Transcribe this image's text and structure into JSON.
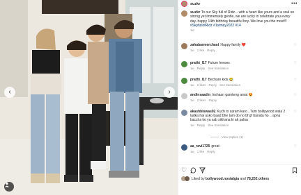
{
  "post": {
    "username": "suzkr",
    "caption_user": "suzkr",
    "caption_text": "To our Sky full of Ridz... with a heart like yours and a soul so strong yet immensely gentle, we are lucky to celebrate you every day..happy 14th birthday beautiful boy..We love you the most!!!",
    "caption_tags": "#SkyfullofRidz #1stmay2022 #14",
    "caption_time": "1w"
  },
  "comments": [
    {
      "user": "zahabarmerchant",
      "text": "Happy family ❤️",
      "time": "1w",
      "likes": "1 like",
      "reply": "Reply",
      "see": ""
    },
    {
      "user": "prathi_l17",
      "text": "Future heroes",
      "time": "1w",
      "likes": "",
      "reply": "Reply",
      "see": "See translation"
    },
    {
      "user": "prathi_l17",
      "text": "Bechare kids 😂",
      "time": "1w",
      "likes": "2 likes",
      "reply": "Reply",
      "see": "See translation"
    },
    {
      "user": "andinsaadin",
      "text": "Inshaan gamteng amat 😍",
      "time": "1w",
      "likes": "2 likes",
      "reply": "Reply",
      "see": ""
    },
    {
      "user": "akashbiswas92",
      "text": "Kuch to saram karo ..Tum bolllywood wala 2 ladka hai usko baad bhe tum do no bf gf banata ho .. apna baccha ko ya sab sikhana ki ak palna",
      "time": "1w",
      "likes": "",
      "reply": "Reply",
      "see": "See translation"
    },
    {
      "user": "aa_ravi1725",
      "text": "great",
      "time": "1w",
      "likes": "1 like",
      "reply": "Reply",
      "see": ""
    }
  ],
  "view_replies": "View replies (1)",
  "actions": {
    "liked_prefix": "Liked by",
    "liked_user": "bollywood.nostalgia",
    "liked_and": "and",
    "liked_count": "78,202 others"
  },
  "colors": {
    "accent": "#0095f6",
    "text": "#262626",
    "muted": "#8e8e8e",
    "link": "#00376b"
  }
}
